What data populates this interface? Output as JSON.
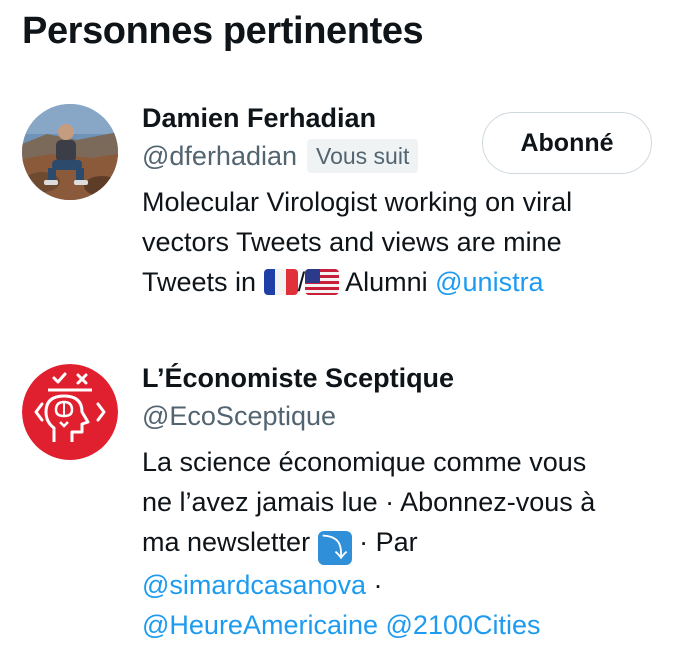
{
  "section": {
    "title": "Personnes pertinentes"
  },
  "people": [
    {
      "name": "Damien Ferhadian",
      "handle": "@dferhadian",
      "follows_you": "Vous suit",
      "follow_button": "Abonné",
      "bio": {
        "line1": "Molecular Virologist working on viral",
        "line2": "vectors Tweets and views are mine",
        "line3_prefix": "Tweets in ",
        "separator": "/",
        "line3_mid": " Alumni ",
        "mention": "@unistra"
      },
      "flags": [
        "france-flag",
        "us-flag"
      ]
    },
    {
      "name": "L’Économiste Sceptique",
      "handle": "@EcoSceptique",
      "bio": {
        "line1": "La science économique comme vous",
        "line2": "ne l’avez jamais lue · Abonnez-vous à",
        "line3_prefix": "ma newsletter ",
        "arrow": "⤵",
        "line3_suffix": " · Par",
        "mention1": "@simardcasanova",
        "line4_suffix": " ·",
        "mention2": "@HeureAmericaine",
        "mention3": "@2100Cities"
      }
    }
  ],
  "colors": {
    "link": "#1d9bf0",
    "secondary": "#536471",
    "logo_red": "#e0202e"
  }
}
